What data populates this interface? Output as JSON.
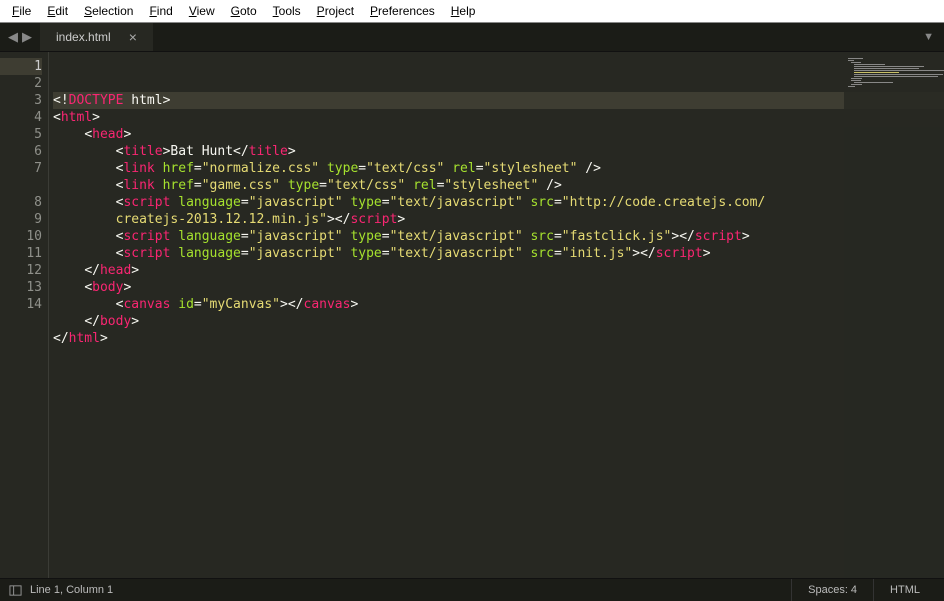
{
  "menu": {
    "items": [
      "File",
      "Edit",
      "Selection",
      "Find",
      "View",
      "Goto",
      "Tools",
      "Project",
      "Preferences",
      "Help"
    ]
  },
  "tabs": {
    "active": {
      "name": "index.html"
    }
  },
  "code": {
    "lines": [
      {
        "n": 1,
        "indent": 0,
        "t": [
          [
            "pun",
            "<!"
          ],
          [
            "doctype",
            "DOCTYPE"
          ],
          [
            "txt",
            " html"
          ],
          [
            "pun",
            ">"
          ]
        ]
      },
      {
        "n": 2,
        "indent": 0,
        "t": [
          [
            "pun",
            "<"
          ],
          [
            "tag",
            "html"
          ],
          [
            "pun",
            ">"
          ]
        ]
      },
      {
        "n": 3,
        "indent": 1,
        "t": [
          [
            "pun",
            "<"
          ],
          [
            "tag",
            "head"
          ],
          [
            "pun",
            ">"
          ]
        ]
      },
      {
        "n": 4,
        "indent": 2,
        "t": [
          [
            "pun",
            "<"
          ],
          [
            "tag",
            "title"
          ],
          [
            "pun",
            ">"
          ],
          [
            "txt",
            "Bat Hunt"
          ],
          [
            "pun",
            "</"
          ],
          [
            "tag",
            "title"
          ],
          [
            "pun",
            ">"
          ]
        ]
      },
      {
        "n": 5,
        "indent": 2,
        "t": [
          [
            "pun",
            "<"
          ],
          [
            "tag",
            "link"
          ],
          [
            "txt",
            " "
          ],
          [
            "attr",
            "href"
          ],
          [
            "op",
            "="
          ],
          [
            "str",
            "\"normalize.css\""
          ],
          [
            "txt",
            " "
          ],
          [
            "attr",
            "type"
          ],
          [
            "op",
            "="
          ],
          [
            "str",
            "\"text/css\""
          ],
          [
            "txt",
            " "
          ],
          [
            "attr",
            "rel"
          ],
          [
            "op",
            "="
          ],
          [
            "str",
            "\"stylesheet\""
          ],
          [
            "txt",
            " "
          ],
          [
            "pun",
            "/>"
          ]
        ]
      },
      {
        "n": 6,
        "indent": 2,
        "t": [
          [
            "pun",
            "<"
          ],
          [
            "tag",
            "link"
          ],
          [
            "txt",
            " "
          ],
          [
            "attr",
            "href"
          ],
          [
            "op",
            "="
          ],
          [
            "str",
            "\"game.css\""
          ],
          [
            "txt",
            " "
          ],
          [
            "attr",
            "type"
          ],
          [
            "op",
            "="
          ],
          [
            "str",
            "\"text/css\""
          ],
          [
            "txt",
            " "
          ],
          [
            "attr",
            "rel"
          ],
          [
            "op",
            "="
          ],
          [
            "str",
            "\"stylesheet\""
          ],
          [
            "txt",
            " "
          ],
          [
            "pun",
            "/>"
          ]
        ]
      },
      {
        "n": 7,
        "indent": 2,
        "t": [
          [
            "pun",
            "<"
          ],
          [
            "tag",
            "script"
          ],
          [
            "txt",
            " "
          ],
          [
            "attr",
            "language"
          ],
          [
            "op",
            "="
          ],
          [
            "str",
            "\"javascript\""
          ],
          [
            "txt",
            " "
          ],
          [
            "attr",
            "type"
          ],
          [
            "op",
            "="
          ],
          [
            "str",
            "\"text/javascript\""
          ],
          [
            "txt",
            " "
          ],
          [
            "attr",
            "src"
          ],
          [
            "op",
            "="
          ],
          [
            "str",
            "\"http://code.createjs.com/"
          ]
        ]
      },
      {
        "n": "",
        "indent": 2,
        "t": [
          [
            "str",
            "createjs-2013.12.12.min.js\""
          ],
          [
            "pun",
            "></"
          ],
          [
            "tag",
            "script"
          ],
          [
            "pun",
            ">"
          ]
        ]
      },
      {
        "n": 8,
        "indent": 2,
        "t": [
          [
            "pun",
            "<"
          ],
          [
            "tag",
            "script"
          ],
          [
            "txt",
            " "
          ],
          [
            "attr",
            "language"
          ],
          [
            "op",
            "="
          ],
          [
            "str",
            "\"javascript\""
          ],
          [
            "txt",
            " "
          ],
          [
            "attr",
            "type"
          ],
          [
            "op",
            "="
          ],
          [
            "str",
            "\"text/javascript\""
          ],
          [
            "txt",
            " "
          ],
          [
            "attr",
            "src"
          ],
          [
            "op",
            "="
          ],
          [
            "str",
            "\"fastclick.js\""
          ],
          [
            "pun",
            "></"
          ],
          [
            "tag",
            "script"
          ],
          [
            "pun",
            ">"
          ]
        ]
      },
      {
        "n": 9,
        "indent": 2,
        "t": [
          [
            "pun",
            "<"
          ],
          [
            "tag",
            "script"
          ],
          [
            "txt",
            " "
          ],
          [
            "attr",
            "language"
          ],
          [
            "op",
            "="
          ],
          [
            "str",
            "\"javascript\""
          ],
          [
            "txt",
            " "
          ],
          [
            "attr",
            "type"
          ],
          [
            "op",
            "="
          ],
          [
            "str",
            "\"text/javascript\""
          ],
          [
            "txt",
            " "
          ],
          [
            "attr",
            "src"
          ],
          [
            "op",
            "="
          ],
          [
            "str",
            "\"init.js\""
          ],
          [
            "pun",
            "></"
          ],
          [
            "tag",
            "script"
          ],
          [
            "pun",
            ">"
          ]
        ]
      },
      {
        "n": 10,
        "indent": 1,
        "t": [
          [
            "pun",
            "</"
          ],
          [
            "tag",
            "head"
          ],
          [
            "pun",
            ">"
          ]
        ]
      },
      {
        "n": 11,
        "indent": 1,
        "t": [
          [
            "pun",
            "<"
          ],
          [
            "tag",
            "body"
          ],
          [
            "pun",
            ">"
          ]
        ]
      },
      {
        "n": 12,
        "indent": 2,
        "t": [
          [
            "pun",
            "<"
          ],
          [
            "tag",
            "canvas"
          ],
          [
            "txt",
            " "
          ],
          [
            "attr",
            "id"
          ],
          [
            "op",
            "="
          ],
          [
            "str",
            "\"myCanvas\""
          ],
          [
            "pun",
            "></"
          ],
          [
            "tag",
            "canvas"
          ],
          [
            "pun",
            ">"
          ]
        ]
      },
      {
        "n": 13,
        "indent": 1,
        "t": [
          [
            "pun",
            "</"
          ],
          [
            "tag",
            "body"
          ],
          [
            "pun",
            ">"
          ]
        ]
      },
      {
        "n": 14,
        "indent": 0,
        "t": [
          [
            "pun",
            "</"
          ],
          [
            "tag",
            "html"
          ],
          [
            "pun",
            ">"
          ]
        ]
      }
    ],
    "activeLine": 1
  },
  "status": {
    "position": "Line 1, Column 1",
    "indent": "Spaces: 4",
    "syntax": "HTML"
  }
}
